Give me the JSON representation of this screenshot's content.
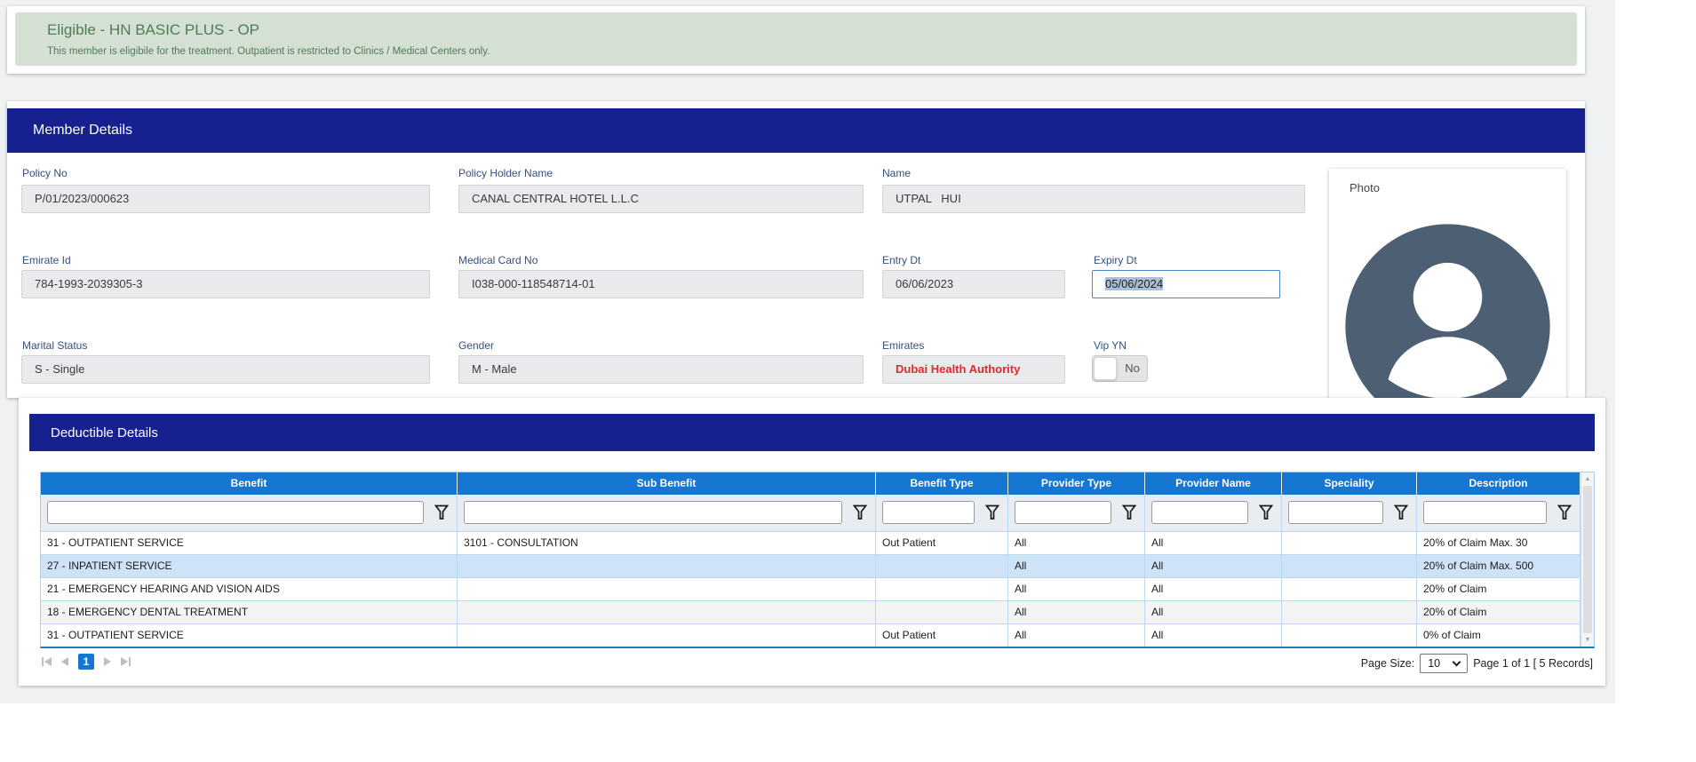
{
  "banner": {
    "title": "Eligible - HN BASIC PLUS - OP",
    "subtitle": "This member is eligibile for the treatment. Outpatient is restricted to Clinics / Medical Centers only."
  },
  "member": {
    "header": "Member Details",
    "photo_label": "Photo",
    "fields": {
      "policy_no": {
        "label": "Policy No",
        "value": "P/01/2023/000623"
      },
      "policy_holder": {
        "label": "Policy Holder Name",
        "value": "CANAL CENTRAL HOTEL L.L.C"
      },
      "name": {
        "label": "Name",
        "value": "UTPAL   HUI"
      },
      "emirate_id": {
        "label": "Emirate Id",
        "value": "784-1993-2039305-3"
      },
      "medical_card": {
        "label": "Medical Card No",
        "value": "I038-000-118548714-01"
      },
      "entry_dt": {
        "label": "Entry Dt",
        "value": "06/06/2023"
      },
      "expiry_dt": {
        "label": "Expiry Dt",
        "value": "05/06/2024"
      },
      "marital": {
        "label": "Marital Status",
        "value": "S - Single"
      },
      "gender": {
        "label": "Gender",
        "value": "M - Male"
      },
      "emirates": {
        "label": "Emirates",
        "value": "Dubai Health Authority"
      },
      "vip": {
        "label": "Vip YN",
        "value": "No"
      }
    }
  },
  "deductible": {
    "header": "Deductible Details",
    "columns": [
      "Benefit",
      "Sub Benefit",
      "Benefit Type",
      "Provider Type",
      "Provider Name",
      "Speciality",
      "Description"
    ],
    "rows": [
      [
        "31 - OUTPATIENT SERVICE",
        "3101 - CONSULTATION",
        "Out Patient",
        "All",
        "All",
        "",
        "20% of Claim Max. 30"
      ],
      [
        "27 - INPATIENT SERVICE",
        "",
        "",
        "All",
        "All",
        "",
        "20% of Claim Max. 500"
      ],
      [
        "21 - EMERGENCY HEARING AND VISION AIDS",
        "",
        "",
        "All",
        "All",
        "",
        "20% of Claim"
      ],
      [
        "18 - EMERGENCY DENTAL TREATMENT",
        "",
        "",
        "All",
        "All",
        "",
        "20% of Claim"
      ],
      [
        "31 - OUTPATIENT SERVICE",
        "",
        "Out Patient",
        "All",
        "All",
        "",
        "0% of Claim"
      ]
    ],
    "selected_row_index": 1,
    "pagination": {
      "current_page": "1",
      "page_size_label": "Page Size:",
      "page_size": "10",
      "info": "Page 1 of 1 [ 5 Records]"
    }
  },
  "icons": {
    "scroll_up_glyph": "▲",
    "scroll_down_glyph": "▼"
  },
  "colors": {
    "navy_header": "#16218f",
    "table_header_blue": "#1677d3",
    "selected_row": "#cfe3f8",
    "alert_red": "#e8262d",
    "banner_green_bg": "#d4e0d3",
    "banner_green_text": "#4e7d54"
  }
}
